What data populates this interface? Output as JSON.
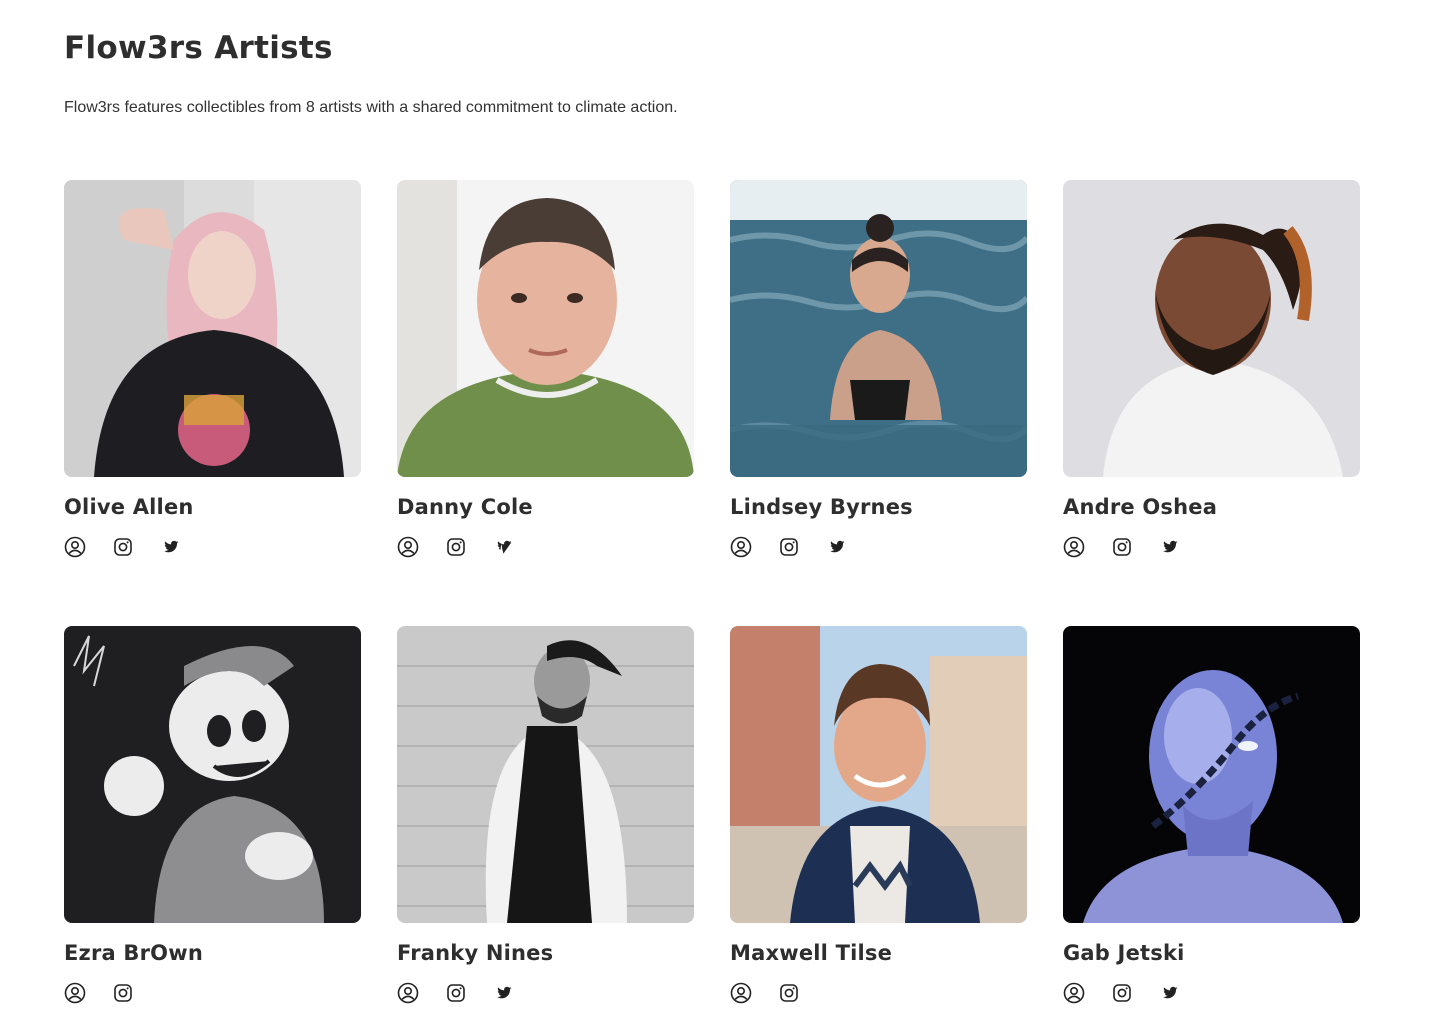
{
  "page": {
    "title": "Flow3rs Artists",
    "subtitle": "Flow3rs features collectibles from 8 artists with a shared commitment to climate action."
  },
  "artists": [
    {
      "name": "Olive Allen",
      "links": [
        "profile-icon",
        "instagram-icon",
        "twitter-icon"
      ]
    },
    {
      "name": "Danny Cole",
      "links": [
        "profile-icon",
        "instagram-icon",
        "twitter-icon"
      ]
    },
    {
      "name": "Lindsey Byrnes",
      "links": [
        "profile-icon",
        "instagram-icon",
        "twitter-icon"
      ]
    },
    {
      "name": "Andre Oshea",
      "links": [
        "profile-icon",
        "instagram-icon",
        "twitter-icon"
      ]
    },
    {
      "name": "Ezra BrOwn",
      "links": [
        "profile-icon",
        "instagram-icon"
      ]
    },
    {
      "name": "Franky Nines",
      "links": [
        "profile-icon",
        "instagram-icon",
        "twitter-icon"
      ]
    },
    {
      "name": "Maxwell Tilse",
      "links": [
        "profile-icon",
        "instagram-icon"
      ]
    },
    {
      "name": "Gab Jetski",
      "links": [
        "profile-icon",
        "instagram-icon",
        "twitter-icon"
      ]
    }
  ],
  "colors": {
    "text": "#2e2e2e",
    "icon": "#222222",
    "background": "#ffffff"
  }
}
